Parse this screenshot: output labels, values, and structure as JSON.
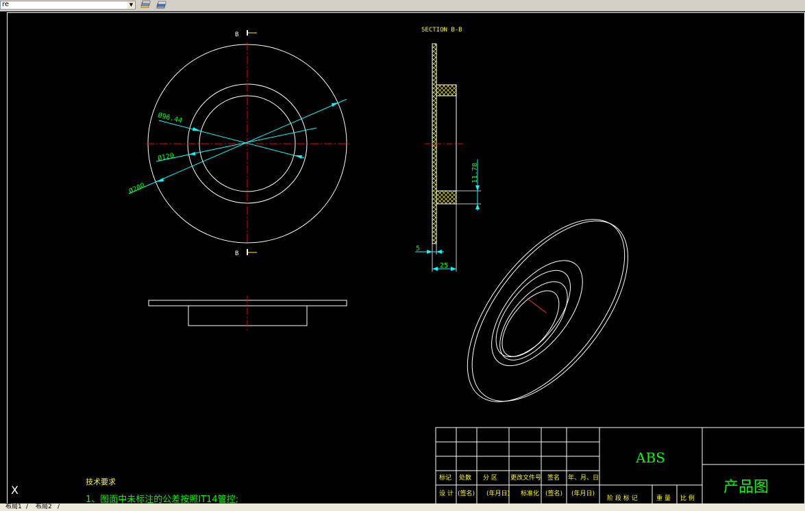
{
  "toolbar": {
    "layer_value": "re",
    "icons": [
      "layer-manager-icon",
      "layer-states-icon"
    ]
  },
  "drawing": {
    "section_marker": "B",
    "section_title": "SECTION B-B",
    "dimensions": {
      "dia_inner": "Ø96.44",
      "dia_mid": "Ø120",
      "dia_outer": "Ø200",
      "height": "11.78",
      "thickness": "5",
      "width": "25"
    },
    "tech_requirements": {
      "heading": "技术要求",
      "item1": "1、图面中未标注的公差按照IT14管控;"
    }
  },
  "title_block": {
    "material": "ABS",
    "drawing_name": "产品图",
    "row_labels": [
      "标记",
      "处数",
      "分 区",
      "更改文件号",
      "签名",
      "年、月、日"
    ],
    "row2_labels": [
      "设 计",
      "(签名)",
      "(年月日)",
      "标准化",
      "(签名)",
      "(年月日)"
    ],
    "stage_labels": "阶 段 标 记",
    "weight_label": "重 量",
    "scale_label": "比 例"
  },
  "ucs_label": "X",
  "layout_tabs": [
    "布局1",
    "布局2"
  ],
  "colors": {
    "background": "#000000",
    "geometry": "#ffffff",
    "centerline": "#ff0000",
    "dimension_line": "#00ffff",
    "dimension_text": "#00ff00",
    "annotation_text": "#ffff00",
    "hatch": "#ffff00"
  }
}
